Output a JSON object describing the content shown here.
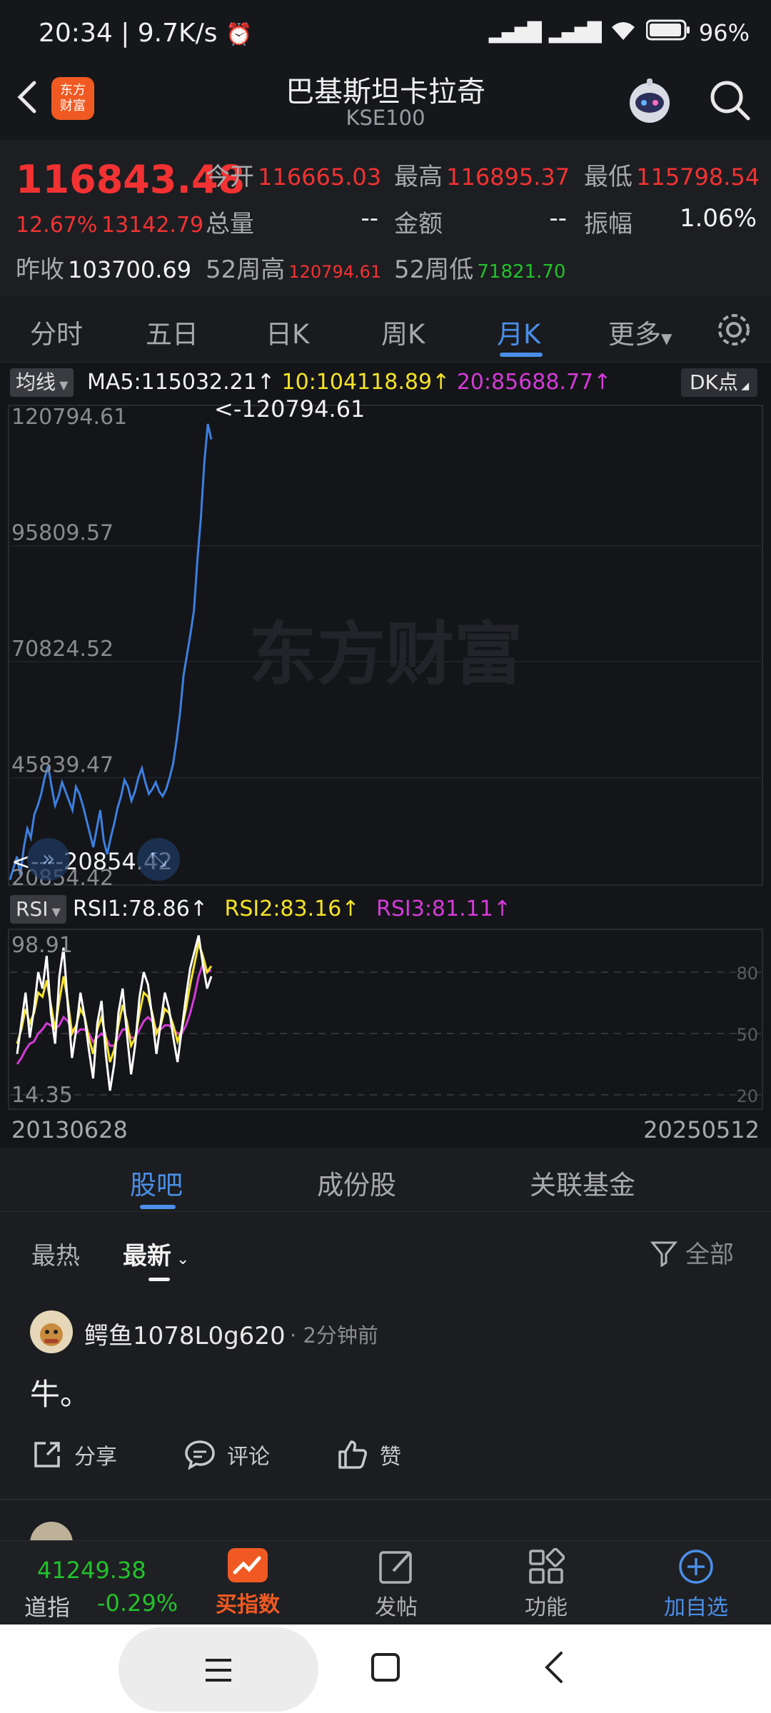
{
  "status_bar": {
    "time": "20:34",
    "speed": "9.7K/s",
    "battery": "96"
  },
  "header": {
    "title": "巴基斯坦卡拉奇",
    "subtitle": "KSE100",
    "logo_text": "东方财富"
  },
  "quote": {
    "price": "116843.48",
    "change_pct": "12.67%",
    "change_abs": "13142.79",
    "open_label": "今开",
    "open": "116665.03",
    "high_label": "最高",
    "high": "116895.37",
    "low_label": "最低",
    "low": "115798.54",
    "volume_label": "总量",
    "volume": "--",
    "amount_label": "金额",
    "amount": "--",
    "amplitude_label": "振幅",
    "amplitude": "1.06%",
    "prev_close_label": "昨收",
    "prev_close": "103700.69",
    "wk52_high_label": "52周高",
    "wk52_high": "120794.61",
    "wk52_low_label": "52周低",
    "wk52_low": "71821.70"
  },
  "tabs": [
    "分时",
    "五日",
    "日K",
    "周K",
    "月K",
    "更多"
  ],
  "active_tab": "月K",
  "indicator": {
    "selector": "均线",
    "ma5": "MA5:115032.21↑",
    "ma10": "10:104118.89↑",
    "ma20": "20:85688.77↑",
    "dk_button": "DK点",
    "rsi_selector": "RSI",
    "rsi1": "RSI1:78.86↑",
    "rsi2": "RSI2:83.16↑",
    "rsi3": "RSI3:81.11↑"
  },
  "watermark": "东方财富",
  "chart_data": {
    "type": "line",
    "price_axis_labels": [
      "120794.61",
      "95809.57",
      "70824.52",
      "45839.47",
      "20854.42"
    ],
    "ylim": [
      20854.42,
      120794.61
    ],
    "max_annotation": "<-120794.61",
    "min_annotation": "<----20854.42",
    "x_start": "20130628",
    "x_end": "20250512",
    "price_series": [
      22000,
      24500,
      27000,
      23000,
      29000,
      33000,
      31000,
      36000,
      38000,
      40500,
      44000,
      46500,
      42000,
      38000,
      40000,
      43000,
      41000,
      39000,
      37000,
      42000,
      40500,
      38000,
      35000,
      32000,
      29000,
      33000,
      37000,
      30500,
      27500,
      31000,
      34000,
      37500,
      40000,
      43500,
      42000,
      39000,
      41000,
      44000,
      46000,
      43000,
      40500,
      41500,
      43000,
      41000,
      40000,
      41500,
      44000,
      47000,
      52000,
      58000,
      66000,
      70500,
      75000,
      80000,
      91000,
      100000,
      112000,
      120794.61,
      116843.48
    ],
    "rsi_axis_labels": [
      "98.91",
      "14.35"
    ],
    "rsi_ylim": [
      14.35,
      98.91
    ],
    "rsi_reference_levels": [
      "80",
      "50",
      "20"
    ],
    "rsi_series": [
      {
        "name": "RSI1",
        "color": "#ffffff",
        "values": [
          40,
          55,
          70,
          48,
          62,
          80,
          72,
          88,
          60,
          45,
          78,
          92,
          64,
          38,
          52,
          70,
          58,
          42,
          28,
          55,
          66,
          40,
          22,
          35,
          60,
          72,
          50,
          30,
          45,
          68,
          80,
          74,
          58,
          40,
          55,
          70,
          62,
          48,
          36,
          52,
          68,
          82,
          90,
          98,
          84,
          72,
          78
        ]
      },
      {
        "name": "RSI2",
        "color": "#f5e326",
        "values": [
          45,
          52,
          62,
          55,
          60,
          70,
          68,
          76,
          64,
          52,
          66,
          78,
          66,
          50,
          54,
          62,
          58,
          48,
          40,
          52,
          58,
          48,
          36,
          42,
          54,
          64,
          56,
          44,
          48,
          60,
          70,
          68,
          60,
          50,
          54,
          62,
          60,
          54,
          46,
          52,
          62,
          74,
          84,
          94,
          88,
          80,
          83
        ]
      },
      {
        "name": "RSI3",
        "color": "#d43bd8",
        "values": [
          35,
          38,
          42,
          45,
          46,
          50,
          52,
          55,
          54,
          52,
          54,
          58,
          56,
          52,
          50,
          52,
          52,
          50,
          46,
          48,
          50,
          48,
          44,
          44,
          48,
          52,
          52,
          48,
          48,
          52,
          56,
          58,
          56,
          52,
          52,
          54,
          54,
          52,
          50,
          50,
          54,
          60,
          68,
          78,
          84,
          80,
          81
        ]
      }
    ]
  },
  "sub_tabs": [
    "股吧",
    "成份股",
    "关联基金"
  ],
  "active_sub_tab": "股吧",
  "feed": {
    "sort_hot": "最热",
    "sort_new": "最新",
    "filter_all": "全部",
    "post": {
      "author": "鳄鱼1078L0g620",
      "time": "2分钟前",
      "content": "牛。",
      "share": "分享",
      "comment": "评论",
      "like": "赞"
    }
  },
  "bottom_bar": {
    "dji_value": "41249.38",
    "dji_label": "道指",
    "dji_change": "-0.29%",
    "buy_index": "买指数",
    "post": "发帖",
    "functions": "功能",
    "add_watch": "加自选"
  },
  "colors": {
    "up": "#f23232",
    "down": "#22c22b",
    "accent": "#4a8fe8",
    "price_line": "#3d7fe0",
    "ma10": "#f5e326",
    "ma20": "#d43bd8"
  }
}
